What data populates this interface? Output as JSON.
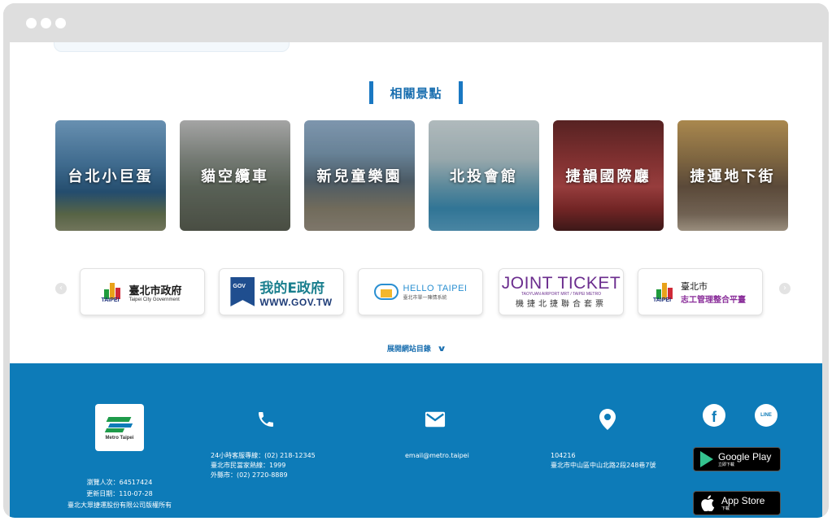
{
  "section": {
    "title": "相關景點"
  },
  "attractions": [
    {
      "label": "台北小巨蛋"
    },
    {
      "label": "貓空纜車"
    },
    {
      "label": "新兒童樂園"
    },
    {
      "label": "北投會館"
    },
    {
      "label": "捷韻國際廳"
    },
    {
      "label": "捷運地下街"
    }
  ],
  "links": {
    "prev_icon": "chevron-left-icon",
    "next_icon": "chevron-right-icon",
    "taipei_gov": {
      "name": "臺北市政府",
      "en": "Taipei City Government",
      "brand": "TAIPEI"
    },
    "egov": {
      "name": "我的E政府",
      "url": "WWW.GOV.TW",
      "badge": "GOV"
    },
    "hello_taipei": {
      "name": "HELLO TAIPEI",
      "sub": "臺北市單一陳情系統"
    },
    "joint_ticket": {
      "name": "JOINT TICKET",
      "mid": "TAOYUAN AIRPORT MRT / TAIPEI METRO",
      "sub": "機捷北捷聯合套票"
    },
    "volunteer": {
      "name": "臺北市",
      "sub": "志工管理整合平臺",
      "brand": "TAIPEI"
    }
  },
  "expand": {
    "label": "展開網站目錄",
    "icon": "chevron-down-icon"
  },
  "footer": {
    "logo_text": "Metro Taipei",
    "stats": {
      "views": "瀏覽人次：64517424",
      "updated": "更新日期：110-07-28",
      "copyright": "臺北大眾捷運股份有限公司版權所有"
    },
    "phone": {
      "line1": "24小時客服專線：(02) 218-12345",
      "line2": "臺北市民當家熱線：1999",
      "line3": "外縣市：(02) 2720-8889"
    },
    "email": "email@metro.taipei",
    "address": {
      "zip": "104216",
      "line": "臺北市中山區中山北路2段248巷7號"
    },
    "social": {
      "facebook": "f",
      "line": "LINE"
    },
    "google_play": {
      "name": "Google Play",
      "sub": "立即下載"
    },
    "app_store": {
      "name": "App Store",
      "sub": "下載"
    }
  },
  "colors": {
    "primary": "#0d7bb8",
    "title": "#1a6fb0"
  }
}
